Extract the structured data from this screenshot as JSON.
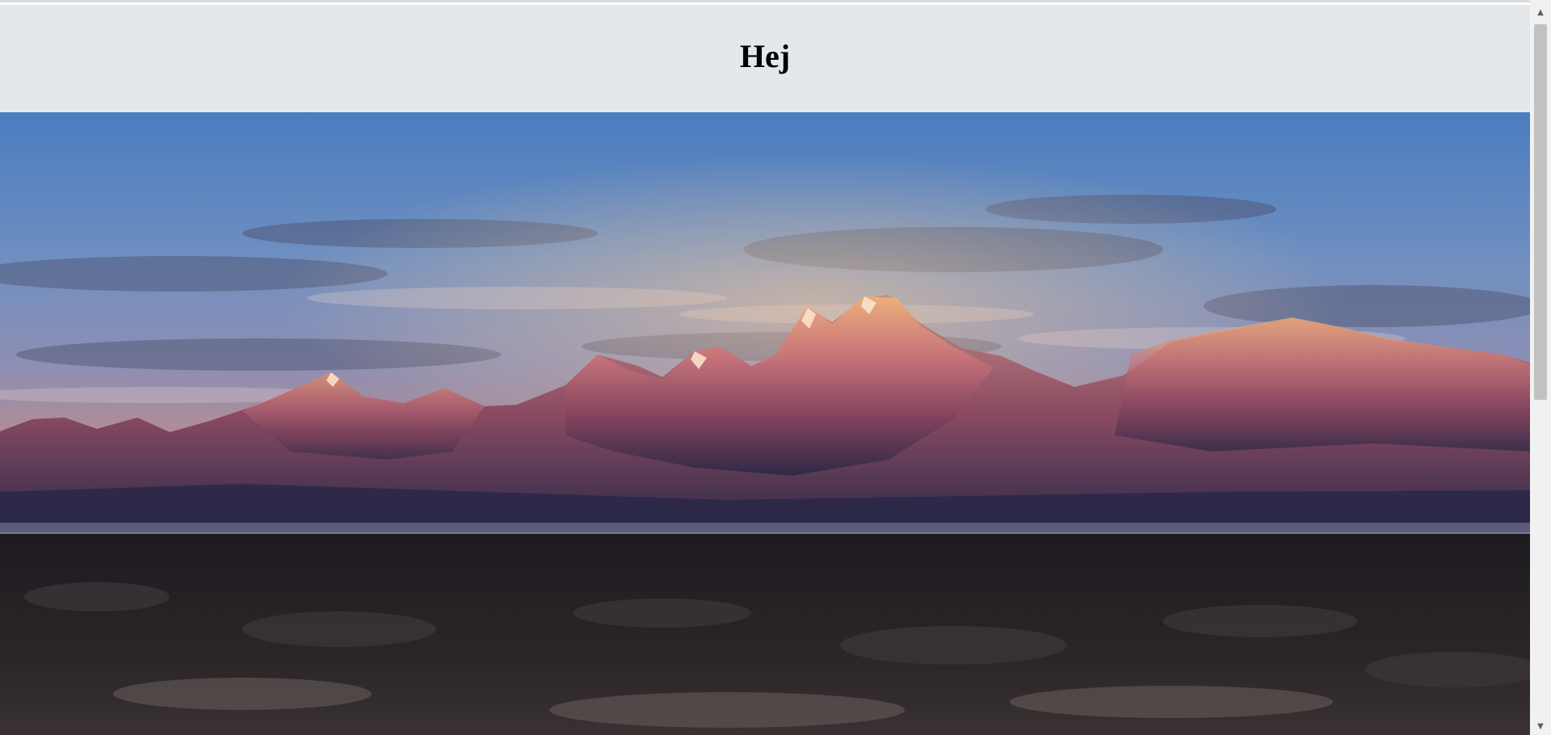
{
  "header": {
    "title": "Hej"
  },
  "hero": {
    "image_description_icon": "mountain-landscape-image"
  },
  "scrollbar": {
    "up_icon": "scroll-up-arrow-icon",
    "down_icon": "scroll-down-arrow-icon",
    "up_glyph": "▲",
    "down_glyph": "▼"
  },
  "colors": {
    "header_bg": "#e5e8ea",
    "sky_top": "#3f78c4",
    "mountain_glow": "#e59a6a",
    "ground": "#1f1c1f"
  }
}
